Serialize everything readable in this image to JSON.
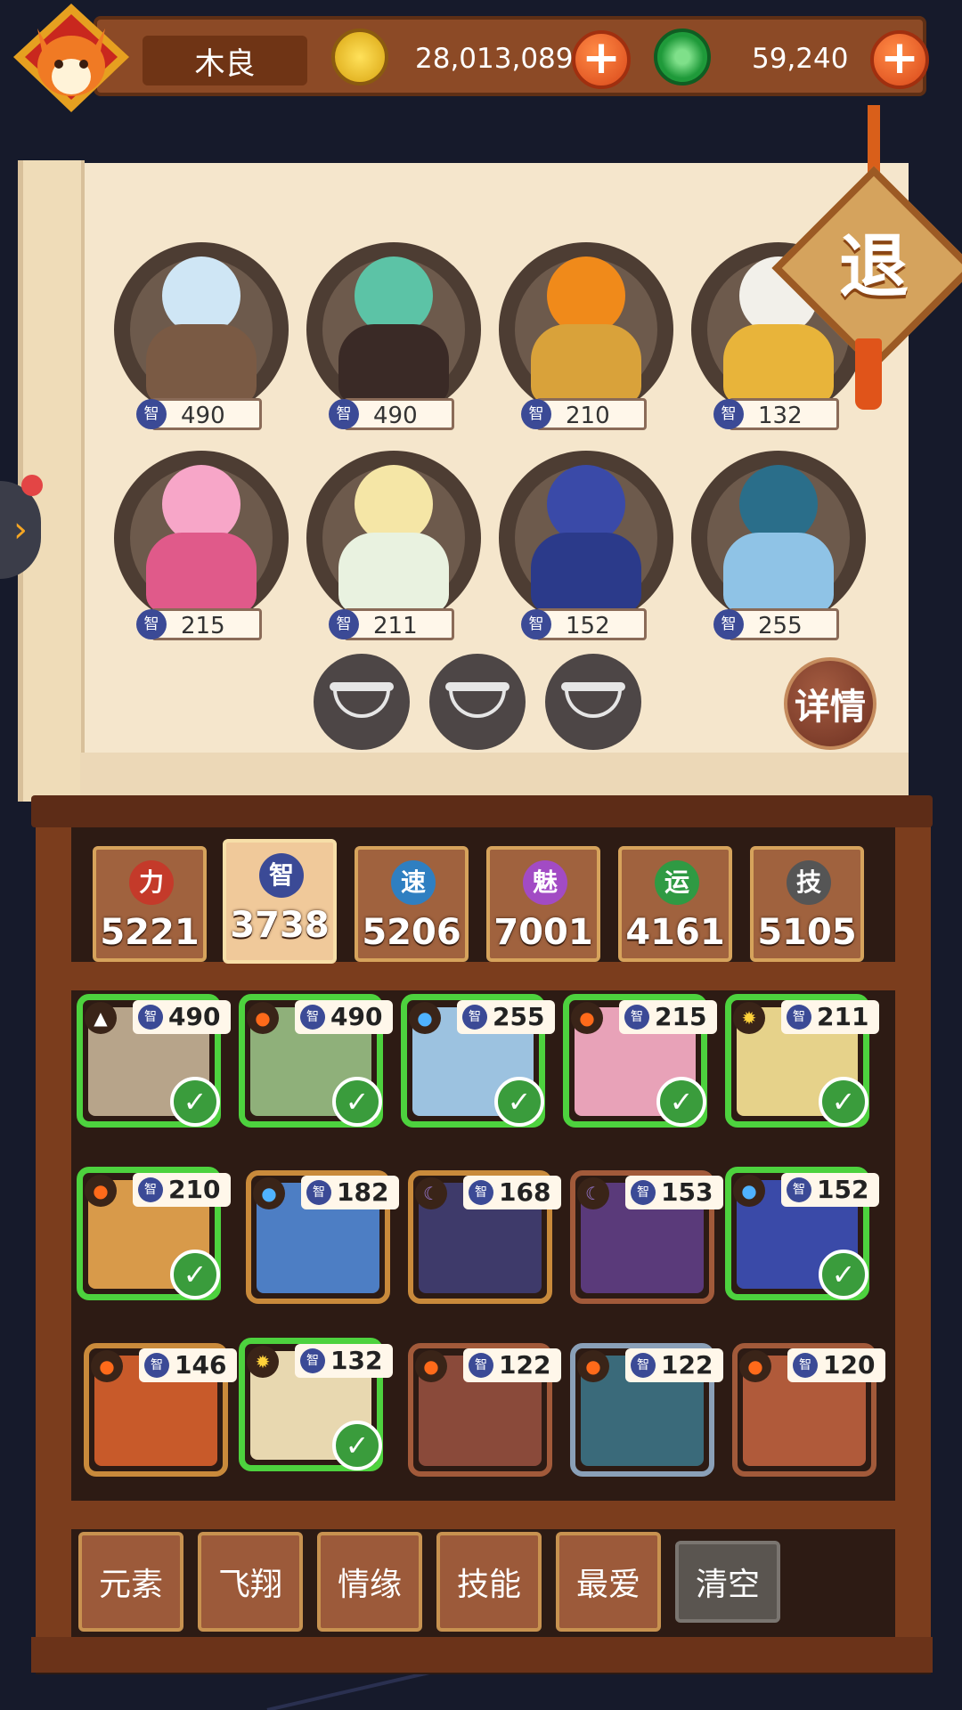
{
  "player": {
    "name": "木良"
  },
  "currencies": [
    {
      "value": "28,013,089",
      "icon": "gold-coin-icon",
      "color": "#f0c020"
    },
    {
      "value": "59,240",
      "icon": "jade-coin-icon",
      "color": "#2db34a"
    }
  ],
  "scroll": {
    "stat_label": "智",
    "team": [
      {
        "value": "490"
      },
      {
        "value": "490"
      },
      {
        "value": "210"
      },
      {
        "value": "132"
      },
      {
        "value": "215"
      },
      {
        "value": "211"
      },
      {
        "value": "152"
      },
      {
        "value": "255"
      }
    ],
    "detail_label": "详情",
    "exit_label": "退"
  },
  "stats": [
    {
      "icon": "力",
      "value": "5221",
      "color": "#c43a2a"
    },
    {
      "icon": "智",
      "value": "3738",
      "color": "#3b4a96",
      "active": true
    },
    {
      "icon": "速",
      "value": "5206",
      "color": "#2f7fc1"
    },
    {
      "icon": "魅",
      "value": "7001",
      "color": "#a24bc4"
    },
    {
      "icon": "运",
      "value": "4161",
      "color": "#2f9a43"
    },
    {
      "icon": "技",
      "value": "5105",
      "color": "#555555"
    }
  ],
  "roster": [
    {
      "value": "490",
      "element": "earth-icon",
      "selected": true
    },
    {
      "value": "490",
      "element": "fire-icon",
      "selected": true
    },
    {
      "value": "255",
      "element": "water-icon",
      "selected": true
    },
    {
      "value": "215",
      "element": "fire-icon",
      "selected": true
    },
    {
      "value": "211",
      "element": "light-icon",
      "selected": true
    },
    {
      "value": "210",
      "element": "fire-icon",
      "selected": true
    },
    {
      "value": "182",
      "element": "water-icon",
      "selected": false
    },
    {
      "value": "168",
      "element": "dark-icon",
      "selected": false
    },
    {
      "value": "153",
      "element": "dark-icon",
      "selected": false
    },
    {
      "value": "152",
      "element": "water-icon",
      "selected": true
    },
    {
      "value": "146",
      "element": "fire-icon",
      "selected": false
    },
    {
      "value": "132",
      "element": "light-icon",
      "selected": true
    },
    {
      "value": "122",
      "element": "fire-icon",
      "selected": false
    },
    {
      "value": "122",
      "element": "fire-icon",
      "selected": false
    },
    {
      "value": "120",
      "element": "fire-icon",
      "selected": false
    }
  ],
  "filters": {
    "element": "元素",
    "fly": "飞翔",
    "bond": "情缘",
    "skill": "技能",
    "favorite": "最爱",
    "clear": "清空"
  }
}
